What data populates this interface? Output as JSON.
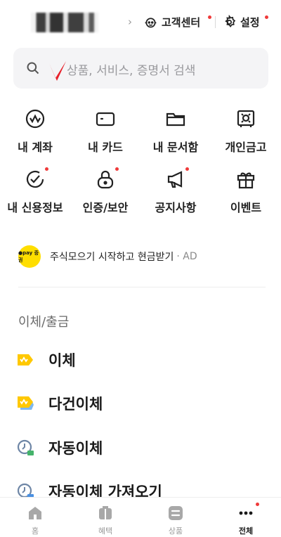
{
  "header": {
    "user_name": "",
    "support_label": "고객센터",
    "settings_label": "설정"
  },
  "search": {
    "placeholder": "상품, 서비스, 증명서 검색"
  },
  "quick_menu": [
    {
      "label": "내 계좌",
      "icon": "account-icon",
      "badge": false
    },
    {
      "label": "내 카드",
      "icon": "card-icon",
      "badge": false
    },
    {
      "label": "내 문서함",
      "icon": "folder-icon",
      "badge": false
    },
    {
      "label": "개인금고",
      "icon": "safe-icon",
      "badge": false
    },
    {
      "label": "내 신용정보",
      "icon": "credit-check-icon",
      "badge": true
    },
    {
      "label": "인증/보안",
      "icon": "lock-icon",
      "badge": true
    },
    {
      "label": "공지사항",
      "icon": "megaphone-icon",
      "badge": true
    },
    {
      "label": "이벤트",
      "icon": "gift-icon",
      "badge": false
    }
  ],
  "ad": {
    "logo_text": "●pay 증권",
    "text": "주식모으기 시작하고 현금받기",
    "tag": "· AD"
  },
  "section": {
    "title": "이체/출금",
    "items": [
      {
        "label": "이체",
        "icon": "transfer-icon"
      },
      {
        "label": "다건이체",
        "icon": "multi-transfer-icon"
      },
      {
        "label": "자동이체",
        "icon": "auto-transfer-icon"
      },
      {
        "label": "자동이체 가져오기",
        "icon": "import-auto-transfer-icon"
      }
    ]
  },
  "bottom_nav": [
    {
      "label": "홈",
      "icon": "home-icon",
      "active": false
    },
    {
      "label": "혜택",
      "icon": "benefit-icon",
      "active": false
    },
    {
      "label": "상품",
      "icon": "products-icon",
      "active": false
    },
    {
      "label": "전체",
      "icon": "more-icon",
      "active": true,
      "badge": true
    }
  ],
  "colors": {
    "accent_yellow": "#ffc800",
    "badge_red": "#ef3a3a",
    "mark_red": "#e8202a"
  }
}
